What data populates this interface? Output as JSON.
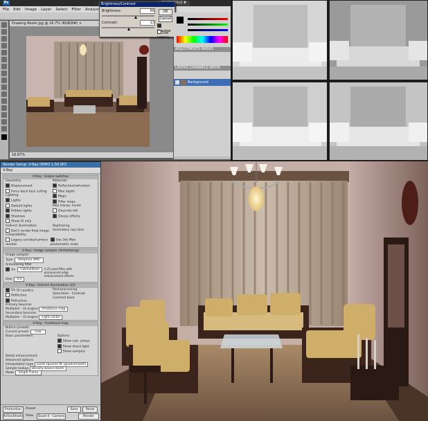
{
  "photoshop": {
    "essentials_label": "ESSENTIALS ▼",
    "menu": [
      "File",
      "Edit",
      "Image",
      "Layer",
      "Select",
      "Filter",
      "Analysis",
      "3D",
      "View",
      "Window"
    ],
    "doc_tab": "Drawing Room.jpg @ 16.7% (RGB/8#) ×",
    "status": "16.67%",
    "brightness_dialog": {
      "title": "Brightness/Contrast",
      "brightness_label": "Brightness:",
      "brightness_value": "60",
      "contrast_label": "Contrast:",
      "contrast_value": "13",
      "ok": "OK",
      "cancel": "Cancel",
      "preview": "Preview",
      "use_legacy": "Use Legacy"
    },
    "adjustments_tab": "ADJUSTMENTS  MASKS",
    "layers_tab": "LAYERS  CHANNELS  PATHS",
    "layer_name": "Background"
  },
  "vray": {
    "title": "Render Setup: V-Ray DEMO 1.50.SP2",
    "tab": "V-Ray",
    "global_switches": "V-Ray:: Global switches",
    "geometry": "Geometry",
    "displacement": "Displacement",
    "force_back": "Force back face culling",
    "lighting": "Lighting",
    "lights": "Lights",
    "default_lights": "Default lights",
    "hidden_lights": "Hidden lights",
    "shadows": "Shadows",
    "show_gi_only": "Show GI only",
    "materials": "Materials",
    "reflection": "Reflection/refraction",
    "max_depth": "Max depth",
    "maps": "Maps",
    "filter_maps": "Filter maps",
    "max_transp": "Max transp. levels",
    "override_mtl": "Override mtl",
    "glossy": "Glossy effects",
    "indirect": "Indirect illumination",
    "dont_render": "Don't render final image",
    "raytracing": "Raytracing",
    "secondary_bias": "Secondary rays bias",
    "compat": "Compatibility",
    "legacy_sun": "Legacy sun/sky/camera models",
    "use_3ds": "Use 3ds Max photometric scale",
    "image_sampler": "V-Ray:: Image sampler (Antialiasing)",
    "image_sampler_grp": "Image sampler",
    "type_label": "Type:",
    "type_value": "Adaptive DMC",
    "aa_filter": "Antialiasing filter",
    "on_label": "On",
    "filter_value": "CatmullRom",
    "filter_desc": "A 25 pixel filter with pronounced edge enhancement effects.",
    "size_label": "Size:",
    "size_value": "4.0",
    "indirect_roll": "V-Ray:: Indirect illumination (GI)",
    "gi_caustics": "GI caustics",
    "reflective": "Reflective",
    "refractive": "Refractive",
    "postprocessing": "Post-processing",
    "saturation": "Saturation",
    "contrast": "Contrast",
    "contrast_base": "Contrast base",
    "primary": "Primary bounces",
    "multiplier": "Multiplier",
    "gi_engine": "GI engine",
    "primary_engine": "Irradiance map",
    "secondary": "Secondary bounces",
    "secondary_engine": "Light cache",
    "irradiance_roll": "V-Ray:: Irradiance map",
    "built_in": "Built-in presets",
    "current_preset": "Current preset:",
    "preset_value": "Low",
    "basic_params": "Basic parameters",
    "options": "Options",
    "show_calc": "Show calc. phase",
    "show_direct": "Show direct light",
    "show_samples": "Show samples",
    "detail_enh": "Detail enhancement",
    "advanced": "Advanced options",
    "interp_type": "Interpolation type",
    "interp_value": "Least squares fit (good/smooth)",
    "sample_lookup": "Sample lookup",
    "lookup_value": "Density-based (best)",
    "multipass": "Multipass",
    "randomize": "Randomize samples",
    "check_vis": "Check sample visibility",
    "mode_label": "Mode",
    "mode_value": "Single frame",
    "save": "Save",
    "reset": "Reset",
    "production": "Production",
    "activeshade": "ActiveShade",
    "preset": "Preset:",
    "view": "View:",
    "view_value": "Quad 4 - Camera",
    "render_btn": "Render"
  }
}
